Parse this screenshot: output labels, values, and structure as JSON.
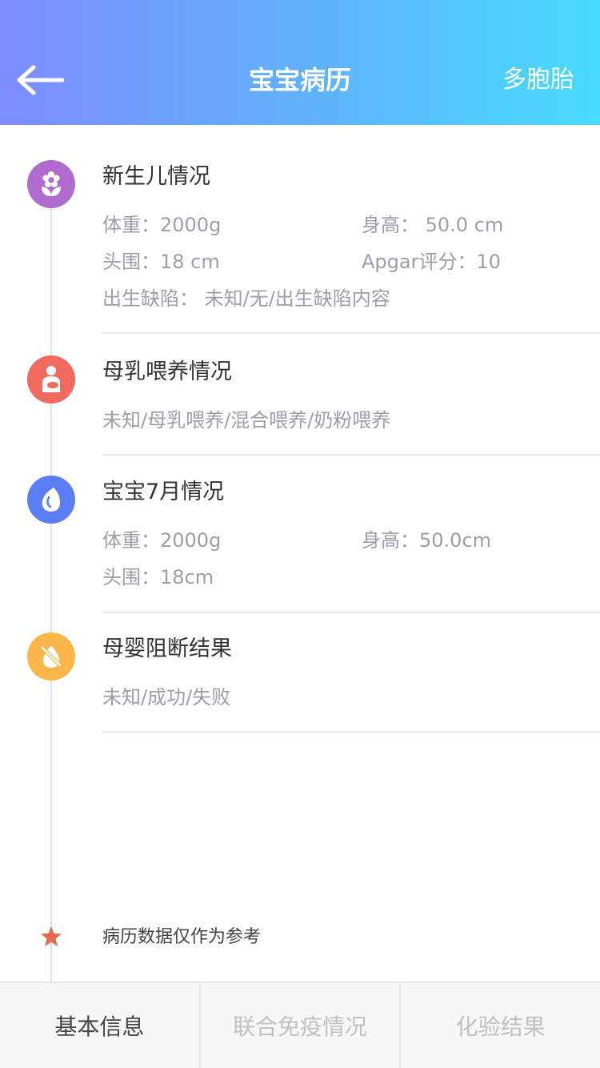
{
  "header": {
    "title": "宝宝病历",
    "right_action": "多胞胎",
    "gradient_colors": [
      "#7d8cff",
      "#47dcfe"
    ]
  },
  "sections": {
    "newborn": {
      "title": "新生儿情况",
      "icon": "flower-icon",
      "color": "#b06bcf",
      "weight": "体重：2000g",
      "height": "身高： 50.0 cm",
      "head": "头围：18 cm",
      "apgar": "Apgar评分：10",
      "defect": "出生缺陷： 未知/无/出生缺陷内容"
    },
    "feeding": {
      "title": "母乳喂养情况",
      "icon": "nursing-mother-icon",
      "color": "#f06a5e",
      "value": "未知/母乳喂养/混合喂养/奶粉喂养"
    },
    "seven_month": {
      "title": "宝宝7月情况",
      "icon": "drop-icon",
      "color": "#5b7df5",
      "weight": "体重：2000g",
      "height": "身高：50.0cm",
      "head": "头围：18cm"
    },
    "blocking": {
      "title": "母婴阻断结果",
      "icon": "blocked-drop-icon",
      "color": "#fbb64a",
      "value": "未知/成功/失败"
    }
  },
  "note": {
    "text": "病历数据仅作为参考",
    "icon": "star-icon",
    "color": "#e8684a"
  },
  "tabs": [
    "基本信息",
    "联合免疫情况",
    "化验结果"
  ]
}
